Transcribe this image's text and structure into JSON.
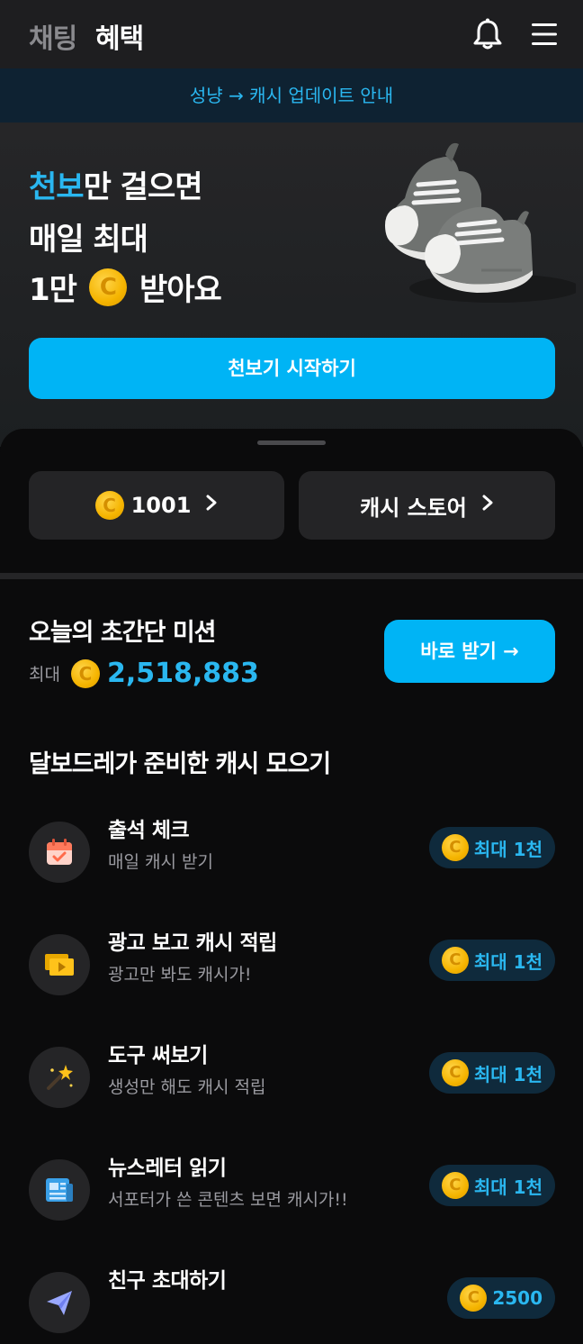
{
  "header": {
    "tab_chatting": "채팅",
    "tab_benefit": "혜택"
  },
  "notice": {
    "text": "성냥 → 캐시 업데이트 안내"
  },
  "hero": {
    "line1_accent": "천보",
    "line1_rest": "만 걸으면",
    "line2": "매일 최대",
    "line3_prefix": "1만",
    "line3_suffix": "받아요",
    "button_label": "천보기 시작하기"
  },
  "wallet": {
    "cash_amount": "1001",
    "store_label": "캐시 스토어"
  },
  "mission": {
    "title": "오늘의 초간단 미션",
    "max_label": "최대",
    "amount": "2,518,883",
    "button_label": "바로 받기 →"
  },
  "cash_section": {
    "title": "달보드레가 준비한 캐시 모으기",
    "items": [
      {
        "title": "출석 체크",
        "subtitle": "매일 캐시 받기",
        "reward": "최대 1천",
        "icon": "calendar-icon"
      },
      {
        "title": "광고 보고 캐시 적립",
        "subtitle": "광고만 봐도 캐시가!",
        "reward": "최대 1천",
        "icon": "video-ad-icon"
      },
      {
        "title": "도구 써보기",
        "subtitle": "생성만 해도 캐시 적립",
        "reward": "최대 1천",
        "icon": "magic-wand-icon"
      },
      {
        "title": "뉴스레터 읽기",
        "subtitle": "서포터가 쓴 콘텐츠 보면 캐시가!!",
        "reward": "최대 1천",
        "icon": "newspaper-icon"
      },
      {
        "title": "친구 초대하기",
        "subtitle": "",
        "reward": "2500",
        "icon": "paper-plane-icon"
      }
    ]
  },
  "colors": {
    "accent": "#00b4f5",
    "accent_text": "#2ab7f0",
    "coin": "#f5b400"
  }
}
